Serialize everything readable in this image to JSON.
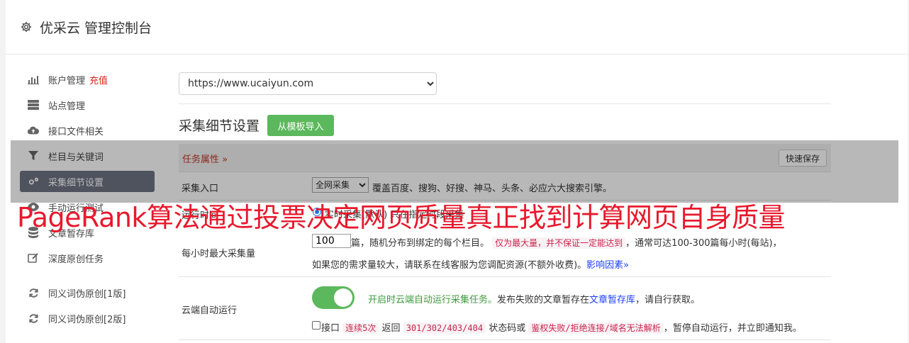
{
  "header": {
    "title": "优采云 管理控制台"
  },
  "sidebar": {
    "items": [
      {
        "label": "账户管理",
        "extra": "充值"
      },
      {
        "label": "站点管理"
      },
      {
        "label": "接口文件相关"
      },
      {
        "label": "栏目与关键词"
      },
      {
        "label": "采集细节设置"
      },
      {
        "label": "手动运行测试"
      },
      {
        "label": "文章暂存库"
      },
      {
        "label": "深度原创任务"
      },
      {
        "label": "同义词伪原创[1版]"
      },
      {
        "label": "同义词伪原创[2版]"
      }
    ]
  },
  "main": {
    "site_select": "https://www.ucaiyun.com",
    "section_title": "采集细节设置",
    "import_button": "从模板导入",
    "task_attr": "任务属性 »",
    "quick_save": "快速保存",
    "entry": {
      "label": "采集入口",
      "select_value": "全网采集",
      "desc": "覆盖百度、搜狗、好搜、神马、头条、必应六大搜索引擎。"
    },
    "run_time": {
      "label": "运行时间",
      "text": "实时采集(默认)  只在指定时段采集"
    },
    "max_per_hour": {
      "label": "每小时最大采集量",
      "value": "100",
      "line1_a": "篇，随机分布到绑定的每个栏目。",
      "line1_tag": "仅为最大量，并不保证一定能达到",
      "line1_b": "，通常可达100-300篇每小时(每站)，",
      "line2_a": "如果您的需求量较大，请联系在线客服为您调配资源(不额外收费)。",
      "line2_link": "影响因素»"
    },
    "cloud": {
      "label": "云端自动运行",
      "line1_green": "开启时云端自动运行采集任务。",
      "line1_a": "发布失败的文章暂存在",
      "line1_link": "文章暂存库",
      "line1_b": "，请自行获取。",
      "line2_a": "接口",
      "line2_tag1": "连续5次",
      "line2_b": "返回",
      "line2_tag2": "301/302/403/404",
      "line2_c": "状态码或",
      "line2_tag3": "鉴权失败/拒绝连接/域名无法解析",
      "line2_d": "，暂停自动运行，并立即通知我。"
    }
  },
  "overlay": {
    "banner": "PageRank算法通过投票决定网页质量真正找到计算网页自身质量"
  }
}
